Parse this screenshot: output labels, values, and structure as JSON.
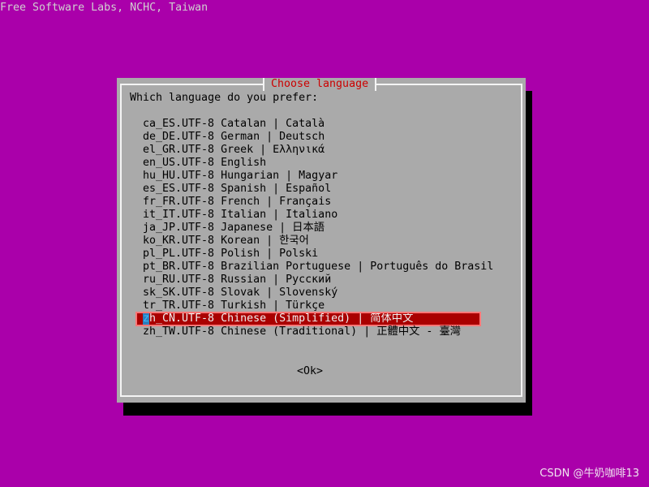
{
  "screen_title": "Free Software Labs, NCHC, Taiwan",
  "dialog": {
    "title": "Choose language",
    "prompt": "Which language do you prefer:",
    "ok_label": "<Ok>",
    "selected_index": 15,
    "languages": [
      {
        "code": "ca_ES.UTF-8",
        "english": "Catalan",
        "native": "Català"
      },
      {
        "code": "de_DE.UTF-8",
        "english": "German",
        "native": "Deutsch"
      },
      {
        "code": "el_GR.UTF-8",
        "english": "Greek",
        "native": "Ελληνικά"
      },
      {
        "code": "en_US.UTF-8",
        "english": "English",
        "native": ""
      },
      {
        "code": "hu_HU.UTF-8",
        "english": "Hungarian",
        "native": "Magyar"
      },
      {
        "code": "es_ES.UTF-8",
        "english": "Spanish",
        "native": "Español"
      },
      {
        "code": "fr_FR.UTF-8",
        "english": "French",
        "native": "Français"
      },
      {
        "code": "it_IT.UTF-8",
        "english": "Italian",
        "native": "Italiano"
      },
      {
        "code": "ja_JP.UTF-8",
        "english": "Japanese",
        "native": "日本語"
      },
      {
        "code": "ko_KR.UTF-8",
        "english": "Korean",
        "native": "한국어"
      },
      {
        "code": "pl_PL.UTF-8",
        "english": "Polish",
        "native": "Polski"
      },
      {
        "code": "pt_BR.UTF-8",
        "english": "Brazilian Portuguese",
        "native": "Português do Brasil"
      },
      {
        "code": "ru_RU.UTF-8",
        "english": "Russian",
        "native": "Русский"
      },
      {
        "code": "sk_SK.UTF-8",
        "english": "Slovak",
        "native": "Slovenský"
      },
      {
        "code": "tr_TR.UTF-8",
        "english": "Turkish",
        "native": "Türkçe"
      },
      {
        "code": "zh_CN.UTF-8",
        "english": "Chinese (Simplified)",
        "native": "简体中文"
      },
      {
        "code": "zh_TW.UTF-8",
        "english": "Chinese (Traditional)",
        "native": "正體中文 - 臺灣"
      }
    ]
  },
  "watermark": "CSDN @牛奶咖啡13",
  "colors": {
    "desktop_background": "#aa00aa",
    "dialog_background": "#aaaaaa",
    "dialog_title": "#cc0000",
    "selection_background": "#aa0000",
    "selection_text": "#f0f0f0",
    "shadow": "#000000"
  }
}
